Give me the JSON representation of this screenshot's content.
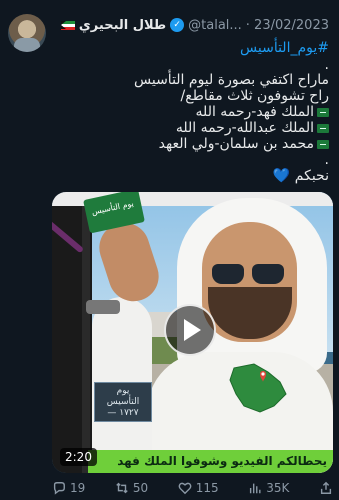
{
  "tweet": {
    "display_name": "طلال البحيري",
    "handle": "@talal...",
    "date": "· 23/02/2023",
    "hashtag": "#يوم_التأسيس",
    "dot1": ".",
    "line1": "ماراح اكتفي بصورة ليوم التأسيس",
    "line2": "راح تشوفون ثلاث مقاطع/",
    "item1": "الملك فهد-رحمه الله",
    "item2": "الملك عبدالله-رحمه الله",
    "item3": "محمد بن سلمان-ولي العهد",
    "dot2": ".",
    "closing": "نحبكم",
    "heart": "💙"
  },
  "media": {
    "banner_label": "يوم التأسيس",
    "logo_line1": "يوم",
    "logo_line2": "التأسيس",
    "logo_line3": "١٧٢٧ —",
    "caption": "يحطالكم الفيديو وشوفوا الملك فهد",
    "duration": "2:20"
  },
  "actions": {
    "replies": "19",
    "retweets": "50",
    "likes": "115",
    "views": "35K"
  },
  "colors": {
    "background": "#0f1720",
    "accent": "#1d9bf0",
    "muted": "#8b98a5"
  }
}
